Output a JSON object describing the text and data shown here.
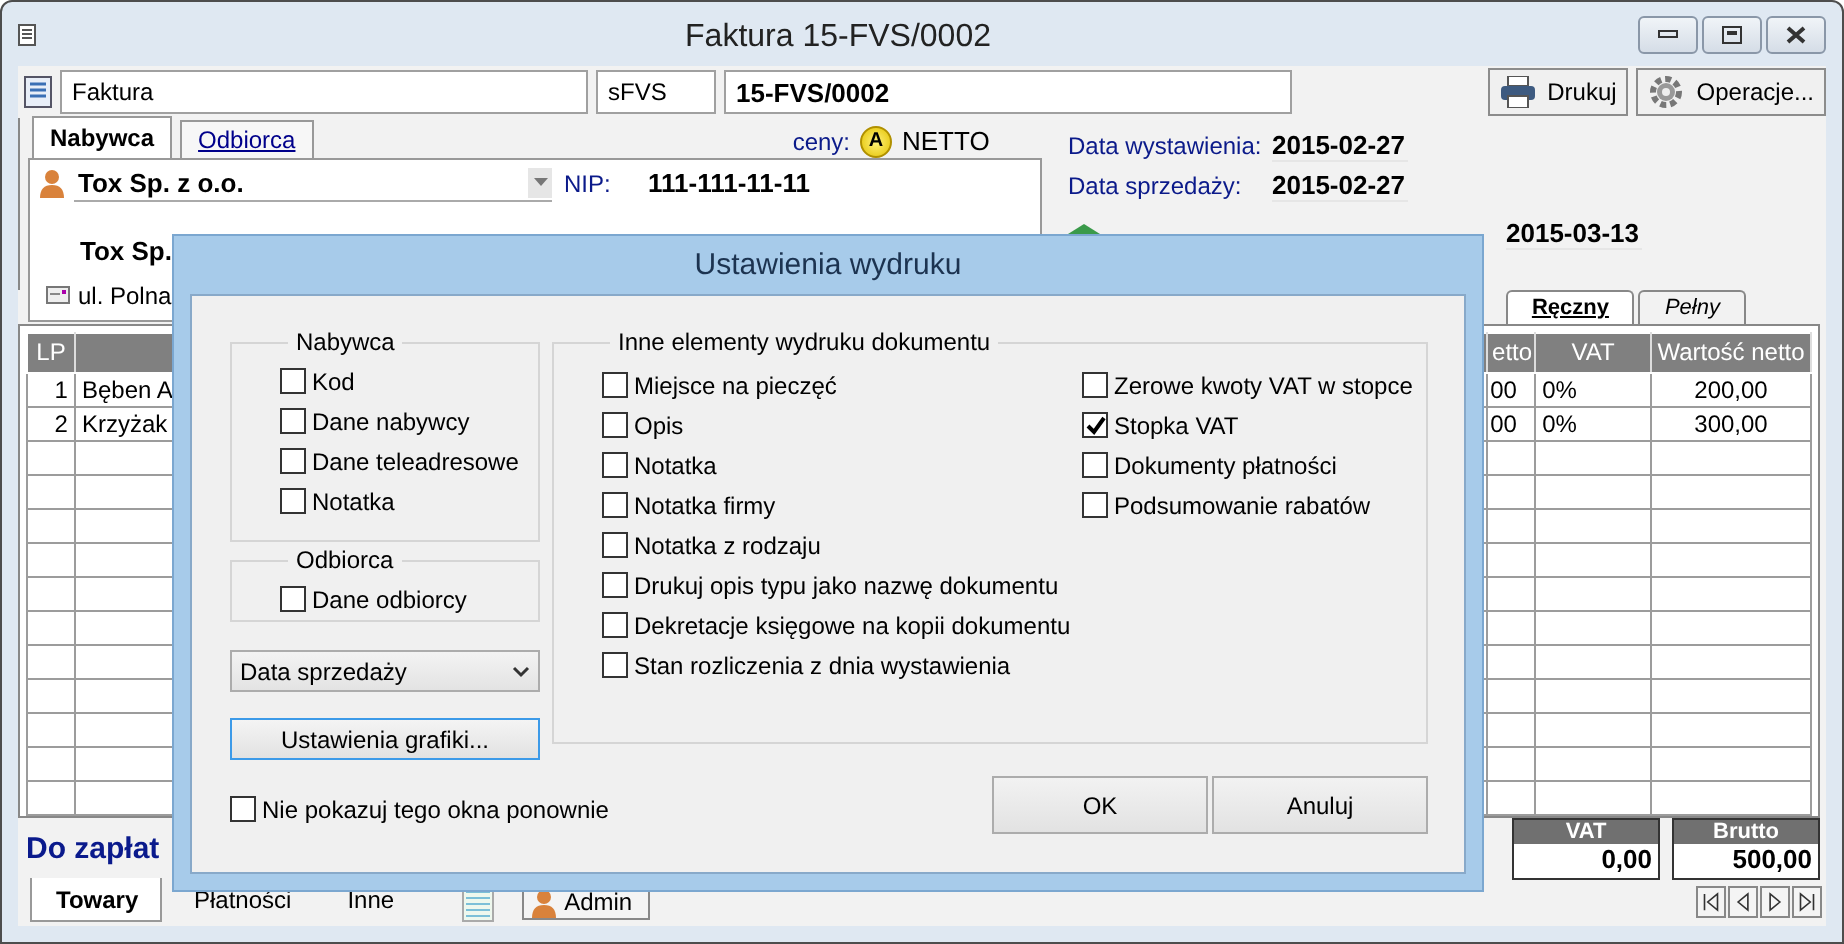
{
  "window": {
    "title": "Faktura 15-FVS/0002"
  },
  "header": {
    "doc_type": "Faktura",
    "series": "sFVS",
    "number": "15-FVS/0002"
  },
  "toolbar": [
    {
      "kind": "print",
      "label": "Drukuj"
    },
    {
      "kind": "operations",
      "label": "Operacje..."
    }
  ],
  "party_tabs": [
    {
      "label": "Nabywca",
      "selected": true
    },
    {
      "label": "Odbiorca",
      "selected": false
    }
  ],
  "prices": {
    "label": "ceny:",
    "badge": "A",
    "mode": "NETTO"
  },
  "buyer": {
    "name": "Tox Sp. z o.o.",
    "nip_label": "NIP:",
    "nip": "111-111-11-11",
    "full_name": "Tox Sp.",
    "address": "ul. Polna"
  },
  "dates": [
    {
      "label": "Data wystawienia:",
      "value": "2015-02-27"
    },
    {
      "label": "Data sprzedaży:",
      "value": "2015-02-27"
    }
  ],
  "payment": {
    "due": "2015-03-13"
  },
  "price_tabs": [
    {
      "label": "Ręczny",
      "selected": true
    },
    {
      "label": "Pełny",
      "selected": false
    }
  ],
  "table": {
    "columns": [
      "LP",
      "etto",
      "VAT",
      "Wartość netto"
    ],
    "rows": [
      {
        "lp": "1",
        "name": "Bęben A",
        "net_price": "00",
        "vat": "0%",
        "net_value": "200,00"
      },
      {
        "lp": "2",
        "name": "Krzyżak",
        "net_price": "00",
        "vat": "0%",
        "net_value": "300,00"
      }
    ]
  },
  "amount_due": "Do zapłat",
  "totals": [
    {
      "label": "VAT",
      "value": "0,00"
    },
    {
      "label": "Brutto",
      "value": "500,00"
    }
  ],
  "bottom_tabs": [
    {
      "label": "Towary",
      "selected": true
    },
    {
      "label": "Płatności",
      "selected": false
    },
    {
      "label": "Inne",
      "selected": false
    }
  ],
  "user": "Admin",
  "dialog": {
    "title": "Ustawienia wydruku",
    "buyer_group": {
      "title": "Nabywca",
      "options": [
        {
          "label": "Kod",
          "checked": false
        },
        {
          "label": "Dane nabywcy",
          "checked": false
        },
        {
          "label": "Dane teleadresowe",
          "checked": false
        },
        {
          "label": "Notatka",
          "checked": false
        }
      ]
    },
    "recipient_group": {
      "title": "Odbiorca",
      "options": [
        {
          "label": "Dane odbiorcy",
          "checked": false
        }
      ]
    },
    "date_select": "Data sprzedaży",
    "graphics_button": "Ustawienia grafiki...",
    "other_group": {
      "title": "Inne elementy wydruku dokumentu",
      "left_options": [
        {
          "label": "Miejsce na pieczęć",
          "checked": false
        },
        {
          "label": "Opis",
          "checked": false
        },
        {
          "label": "Notatka",
          "checked": false
        },
        {
          "label": "Notatka firmy",
          "checked": false
        },
        {
          "label": "Notatka z rodzaju",
          "checked": false
        },
        {
          "label": "Drukuj opis typu jako nazwę dokumentu",
          "checked": false
        },
        {
          "label": "Dekretacje księgowe na kopii dokumentu",
          "checked": false
        },
        {
          "label": "Stan rozliczenia z dnia wystawienia",
          "checked": false
        }
      ],
      "right_options": [
        {
          "label": "Zerowe kwoty VAT w stopce",
          "checked": false
        },
        {
          "label": "Stopka VAT",
          "checked": true
        },
        {
          "label": "Dokumenty płatności",
          "checked": false
        },
        {
          "label": "Podsumowanie rabatów",
          "checked": false
        }
      ]
    },
    "dont_show": {
      "label": "Nie pokazuj tego okna ponownie",
      "checked": false
    },
    "buttons": [
      "OK",
      "Anuluj"
    ]
  }
}
